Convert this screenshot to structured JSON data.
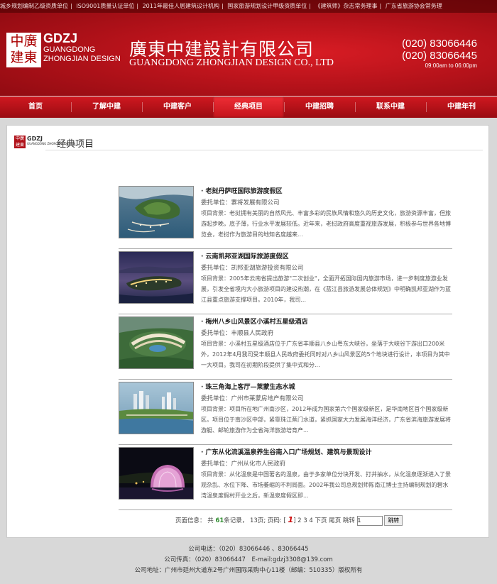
{
  "ticker": [
    "城乡规划编制乙级资质单位",
    "ISO9001质量认证单位",
    "2011年最佳人居建筑设计机构",
    "国家旅游规划设计甲级资质单位",
    "《建筑师》杂志常务理事",
    "广东省旅游协会常务理"
  ],
  "logo": {
    "cn": "中廣建東",
    "en_big": "GDZJ",
    "en_line1": "GUANGDONG",
    "en_line2": "ZHONGJIAN DESIGN"
  },
  "company": {
    "cn": "廣東中建設計有限公司",
    "en": "GUANGDONG ZHONGJIAN DESIGN CO., LTD"
  },
  "phones": [
    "(020) 83066446",
    "(020) 83066445"
  ],
  "hours": "09:00am to 06:00pm",
  "nav": [
    {
      "label": "首页",
      "active": false
    },
    {
      "label": "了解中建",
      "active": false
    },
    {
      "label": "中建客户",
      "active": false
    },
    {
      "label": "经典项目",
      "active": true
    },
    {
      "label": "中建招聘",
      "active": false
    },
    {
      "label": "联系中建",
      "active": false
    },
    {
      "label": "中建年刊",
      "active": false
    }
  ],
  "section": {
    "logo_big": "GDZJ",
    "logo_small": "GUANGDONG ZHONGJIAN DESIGN",
    "title": "经典项目"
  },
  "projects": [
    {
      "title": "· 老挝丹萨旺国际旅游度假区",
      "client": "委托单位：寨将发展有限公司",
      "desc": "项目背景：老挝拥有美丽的自然风光、丰富多彩的民族风情和悠久的历史文化，旅游资源丰富，但旅游起步晚，底子薄，行业水平发展较低。近年来，老挝政府高度重视旅游发展，积极参与世界各地博览会，老挝作为旅游目的地知名度越来..."
    },
    {
      "title": "· 云南凯邦亚湖国际旅游度假区",
      "client": "委托单位：凯邦亚湖旅游投资有限公司",
      "desc": "项目背景：2005年云南省提出旅游\"二次创业\"，全面开拓国际国内旅游市场，进一步制度旅游业发展，引发全省境内大小旅游项目的建设热潮，在《蓝江县旅游发展总体规划》中明确凯邦亚湖作为蓝江县重点旅游支撑项目。2010年，我司..."
    },
    {
      "title": "· 梅州八乡山风景区小溪村五星级酒店",
      "client": "委托单位：丰顺县人民政府",
      "desc": "项目背景：小溪村五星级酒店位于广东省丰顺县八乡山粤东大峡谷，坐落于大峡谷下游出口200米外，2012年4月我司受丰顺县人民政府委托同时对八乡山风景区的5个地块进行设计，本项目为其中一大项目。我司在初期阶段提供了集中式和分..."
    },
    {
      "title": "· 珠三角海上客厅—莱蒙生态水城",
      "client": "委托单位：广州市莱蒙房地产有限公司",
      "desc": "项目背景：项目所在地广州南沙区，2012年成为国家第六个国家级新区，是华南地区首个国家级新区。项目位于南沙区中部，紧靠珠江蕉门水道，紧抓国家大力发展海洋经济，广东省滨海旅游发展将游艇、邮轮旅游作为全省海洋旅游培育产..."
    },
    {
      "title": "· 广东从化流溪温泉养生谷南入口广场规划、建筑与景观设计",
      "client": "委托单位：广州从化市人民政府",
      "desc": "项目背景：从化温泉是中国著名的温泉，由于多家单位分块开发、打井抽水，从化温泉逐渐进入了景观杂乱、水位下降、市场萎缩的不利局面。2002年我公司总规划师陈南江博士主持编制规划的碧水湾温泉度假村开业之后，新温泉度假区即..."
    }
  ],
  "pager": {
    "label": "页面信息：",
    "total_prefix": "共",
    "total": "61",
    "total_suffix": "条记录，",
    "pages": "13",
    "pages_suffix": "页; 页码: [",
    "current": "1",
    "rest": "] 2 3 4 下页 尾页 跳转",
    "jump_value": "1",
    "jump_button": "跳转"
  },
  "footer": {
    "phone": "公司电话：（020）83066446 、83066445",
    "fax": "公司传真：（020）83066447　E-mail:gdzj3308@139.com",
    "address": "公司地址：广州市廷州大道东2号广州国际采购中心11楼（邮编：510335）版权所有"
  }
}
